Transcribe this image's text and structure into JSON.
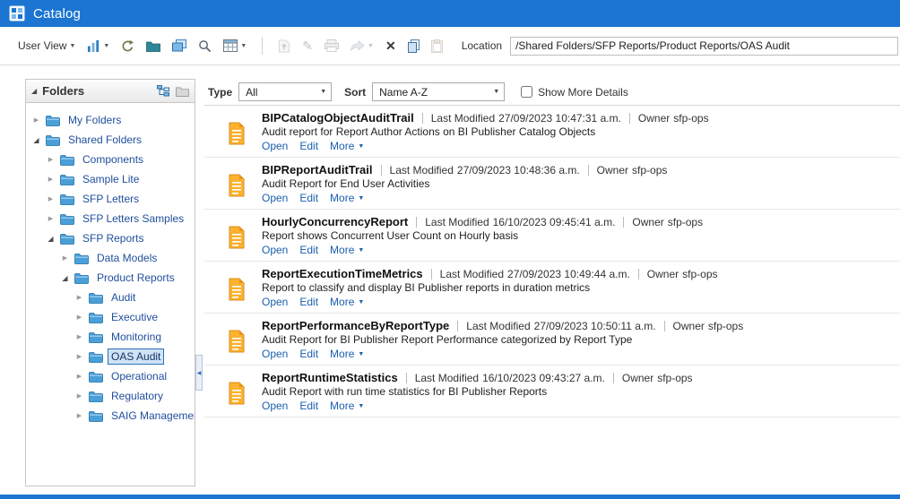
{
  "header": {
    "title": "Catalog"
  },
  "toolbar": {
    "user_view_label": "User View",
    "location_label": "Location",
    "location_value": "/Shared Folders/SFP Reports/Product Reports/OAS Audit",
    "icons": [
      "chart-view-icon",
      "refresh-icon",
      "new-folder-icon",
      "copy-folder-icon",
      "search-icon",
      "table-view-icon",
      "upload-icon",
      "edit-pencil-icon",
      "print-icon",
      "share-icon",
      "delete-icon",
      "copy-icon",
      "paste-icon"
    ]
  },
  "folders_panel": {
    "title": "Folders",
    "items": [
      {
        "label": "My Folders",
        "level": 0,
        "state": "collapsed",
        "selected": false
      },
      {
        "label": "Shared Folders",
        "level": 0,
        "state": "expanded",
        "selected": false
      },
      {
        "label": "Components",
        "level": 1,
        "state": "collapsed",
        "selected": false
      },
      {
        "label": "Sample Lite",
        "level": 1,
        "state": "collapsed",
        "selected": false
      },
      {
        "label": "SFP Letters",
        "level": 1,
        "state": "collapsed",
        "selected": false
      },
      {
        "label": "SFP Letters Samples",
        "level": 1,
        "state": "collapsed",
        "selected": false
      },
      {
        "label": "SFP Reports",
        "level": 1,
        "state": "expanded",
        "selected": false
      },
      {
        "label": "Data Models",
        "level": 2,
        "state": "collapsed",
        "selected": false
      },
      {
        "label": "Product Reports",
        "level": 2,
        "state": "expanded",
        "selected": false
      },
      {
        "label": "Audit",
        "level": 3,
        "state": "collapsed",
        "selected": false
      },
      {
        "label": "Executive",
        "level": 3,
        "state": "collapsed",
        "selected": false
      },
      {
        "label": "Monitoring",
        "level": 3,
        "state": "collapsed",
        "selected": false
      },
      {
        "label": "OAS Audit",
        "level": 3,
        "state": "collapsed",
        "selected": true
      },
      {
        "label": "Operational",
        "level": 3,
        "state": "collapsed",
        "selected": false
      },
      {
        "label": "Regulatory",
        "level": 3,
        "state": "collapsed",
        "selected": false
      },
      {
        "label": "SAIG Management",
        "level": 3,
        "state": "collapsed",
        "selected": false
      }
    ]
  },
  "filter_bar": {
    "type_label": "Type",
    "type_value": "All",
    "sort_label": "Sort",
    "sort_value": "Name A-Z",
    "show_more_details_label": "Show More Details",
    "show_more_details_checked": false
  },
  "report_labels": {
    "last_modified": "Last Modified",
    "owner": "Owner",
    "open": "Open",
    "edit": "Edit",
    "more": "More"
  },
  "reports": [
    {
      "name": "BIPCatalogObjectAuditTrail",
      "last_modified": "27/09/2023 10:47:31 a.m.",
      "owner": "sfp-ops",
      "description": "Audit report for Report Author Actions on BI Publisher Catalog Objects"
    },
    {
      "name": "BIPReportAuditTrail",
      "last_modified": "27/09/2023 10:48:36 a.m.",
      "owner": "sfp-ops",
      "description": "Audit Report for End User Activities"
    },
    {
      "name": "HourlyConcurrencyReport",
      "last_modified": "16/10/2023 09:45:41 a.m.",
      "owner": "sfp-ops",
      "description": "Report shows Concurrent User Count on Hourly basis"
    },
    {
      "name": "ReportExecutionTimeMetrics",
      "last_modified": "27/09/2023 10:49:44 a.m.",
      "owner": "sfp-ops",
      "description": "Report to classify and display BI Publisher reports in duration metrics"
    },
    {
      "name": "ReportPerformanceByReportType",
      "last_modified": "27/09/2023 10:50:11 a.m.",
      "owner": "sfp-ops",
      "description": "Audit Report for BI Publisher Report Performance categorized by Report Type"
    },
    {
      "name": "ReportRuntimeStatistics",
      "last_modified": "16/10/2023 09:43:27 a.m.",
      "owner": "sfp-ops",
      "description": "Audit Report with run time statistics for BI Publisher Reports"
    }
  ],
  "glyphs": {
    "caret_down": "▼",
    "twisty_collapsed": "▶",
    "twisty_expanded": "◢",
    "panel_disclosure": "◢",
    "splitter_arrow": "◀",
    "pencil": "✎",
    "delete": "✕"
  },
  "colors": {
    "header_bar": "#1b75d1",
    "link": "#1a5fb0",
    "folder_icon": "#4a9fd8",
    "report_icon": "#fbb034",
    "selected_bg": "#cfe3f7",
    "selected_border": "#2f6fb7"
  }
}
